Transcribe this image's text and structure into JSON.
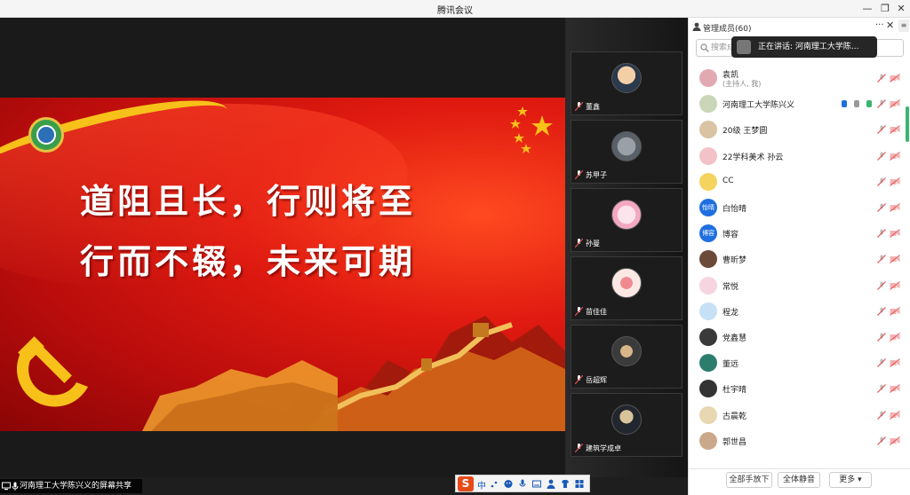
{
  "window": {
    "title": "腾讯会议"
  },
  "slide": {
    "line1": "道阻且长，行则将至",
    "line2": "行而不辍，未来可期"
  },
  "share": {
    "label": "河南理工大学陈兴义的屏幕共享"
  },
  "thumbnails": [
    {
      "name": "董鑫"
    },
    {
      "name": "苏甲子"
    },
    {
      "name": "孙曼"
    },
    {
      "name": "苗佳佳"
    },
    {
      "name": "岳超辉"
    },
    {
      "name": "建筑学成卓"
    }
  ],
  "panel": {
    "title": "管理成员(60)",
    "more": "···",
    "search_placeholder": "搜索成员",
    "speaking": "正在讲话: 河南理工大学陈...",
    "footer": {
      "raise": "全部手放下",
      "mute_all": "全体静音",
      "more": "更多 ▾"
    }
  },
  "members": [
    {
      "name": "袁凯",
      "sub": "(主持人, 我)",
      "avatar_text": ""
    },
    {
      "name": "河南理工大学陈兴义",
      "sub": "",
      "avatar_text": ""
    },
    {
      "name": "20级 王梦圆",
      "sub": "",
      "avatar_text": ""
    },
    {
      "name": "22学科美术  孙云",
      "sub": "",
      "avatar_text": ""
    },
    {
      "name": "CC",
      "sub": "",
      "avatar_text": ""
    },
    {
      "name": "白怡晴",
      "sub": "",
      "avatar_text": "怡晴"
    },
    {
      "name": "博容",
      "sub": "",
      "avatar_text": "博容"
    },
    {
      "name": "曹昕梦",
      "sub": "",
      "avatar_text": ""
    },
    {
      "name": "常悦",
      "sub": "",
      "avatar_text": ""
    },
    {
      "name": "程龙",
      "sub": "",
      "avatar_text": ""
    },
    {
      "name": "党鑫慧",
      "sub": "",
      "avatar_text": ""
    },
    {
      "name": "董远",
      "sub": "",
      "avatar_text": ""
    },
    {
      "name": "杜宇晴",
      "sub": "",
      "avatar_text": ""
    },
    {
      "name": "古晨乾",
      "sub": "",
      "avatar_text": ""
    },
    {
      "name": "郭世昌",
      "sub": "",
      "avatar_text": ""
    }
  ],
  "ime": {
    "mode": "中"
  },
  "colors": {
    "accent": "#1f6fe0",
    "slide_red": "#e01a10",
    "gold": "#f7c11a",
    "mic_off": "#e05050"
  }
}
